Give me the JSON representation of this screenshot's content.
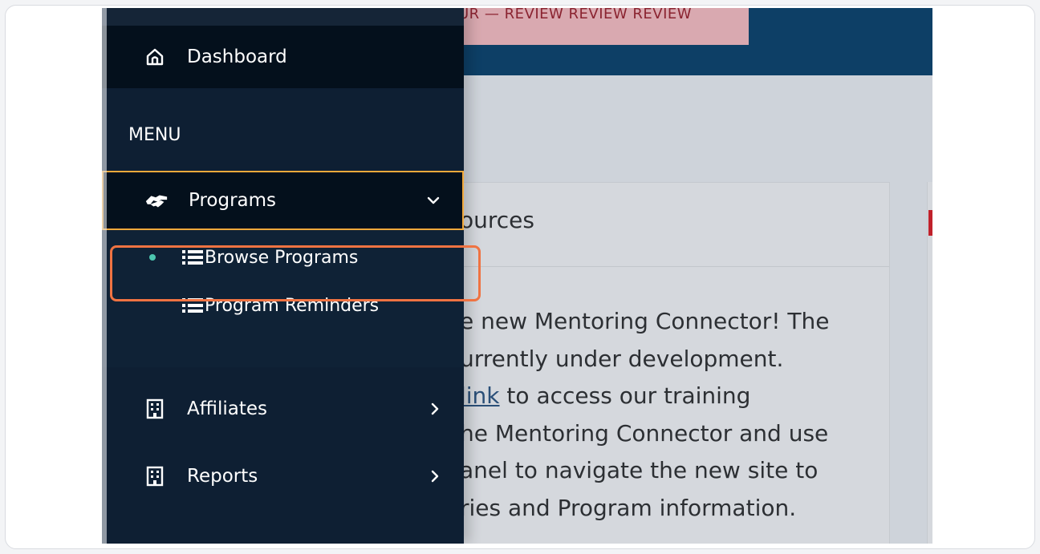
{
  "banner": {
    "text": "UR — REVIEW REVIEW REVIEW"
  },
  "card": {
    "title": "ources",
    "body_lines": [
      "e new Mentoring Connector! The",
      "urrently under development.",
      " to access our training",
      "he Mentoring Connector and use",
      "anel to navigate the new site to",
      "ries and Program information."
    ],
    "link_text": "link"
  },
  "sidebar": {
    "dashboard": {
      "label": "Dashboard",
      "icon": "home-icon"
    },
    "menu_heading": "MENU",
    "programs": {
      "label": "Programs",
      "icon": "handshake-icon",
      "expanded": true
    },
    "submenu": [
      {
        "label": "Browse Programs",
        "icon": "list-icon",
        "active": true
      },
      {
        "label": "Program Reminders",
        "icon": "list-icon",
        "active": false
      }
    ],
    "affiliates": {
      "label": "Affiliates",
      "icon": "building-icon"
    },
    "reports": {
      "label": "Reports",
      "icon": "building-icon"
    }
  },
  "colors": {
    "sidebar_bg": "#0e1f33",
    "active_bg": "#04101c",
    "programs_border": "#f2a93b",
    "highlight_border": "#ef7342",
    "active_bullet": "#4cc7b0",
    "topbar": "#0d3f66"
  }
}
